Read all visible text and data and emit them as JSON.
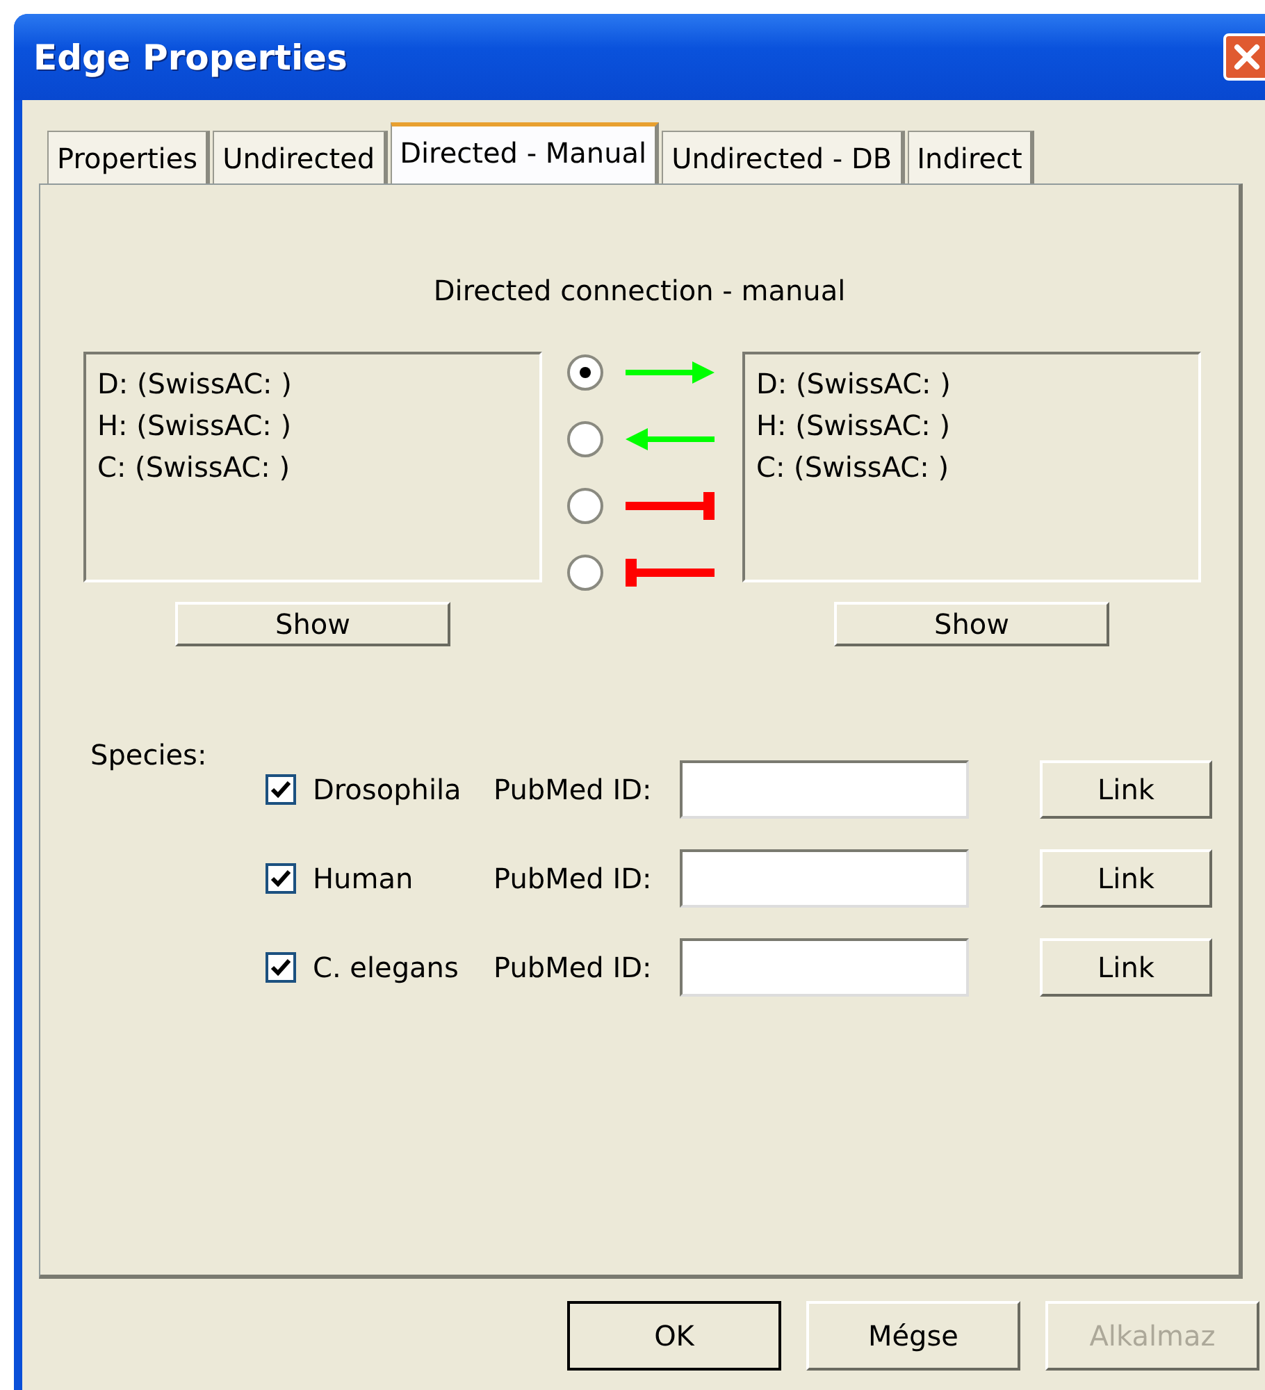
{
  "window": {
    "title": "Edge Properties"
  },
  "tabs": [
    {
      "label": "Properties",
      "selected": false
    },
    {
      "label": "Undirected",
      "selected": false
    },
    {
      "label": "Directed - Manual",
      "selected": true
    },
    {
      "label": "Undirected - DB",
      "selected": false
    },
    {
      "label": "Indirect",
      "selected": false
    }
  ],
  "heading": "Directed connection - manual",
  "source_list": {
    "lines": [
      "D:  (SwissAC: )",
      "H:  (SwissAC: )",
      "C:  (SwissAC: )"
    ],
    "button": "Show"
  },
  "direction_options": [
    {
      "kind": "arrow_right",
      "color": "#00ff00",
      "selected": true
    },
    {
      "kind": "arrow_left",
      "color": "#00ff00",
      "selected": false
    },
    {
      "kind": "bar_right",
      "color": "#ff0000",
      "selected": false
    },
    {
      "kind": "bar_left",
      "color": "#ff0000",
      "selected": false
    }
  ],
  "target_list": {
    "lines": [
      "D:  (SwissAC: )",
      "H:  (SwissAC: )",
      "C:  (SwissAC: )"
    ],
    "button": "Show"
  },
  "species_label": "Species:",
  "species": [
    {
      "name": "Drosophila",
      "checked": true,
      "id_label": "PubMed ID:",
      "button": "Link"
    },
    {
      "name": "Human",
      "checked": true,
      "id_label": "PubMed ID:",
      "button": "Link"
    },
    {
      "name": "C. elegans",
      "checked": true,
      "id_label": "PubMed ID:",
      "button": "Link"
    }
  ],
  "buttons": [
    {
      "label": "OK",
      "default": true,
      "disabled": false
    },
    {
      "label": "Mégse",
      "default": false,
      "disabled": false
    },
    {
      "label": "Alkalmaz",
      "default": false,
      "disabled": true
    }
  ]
}
